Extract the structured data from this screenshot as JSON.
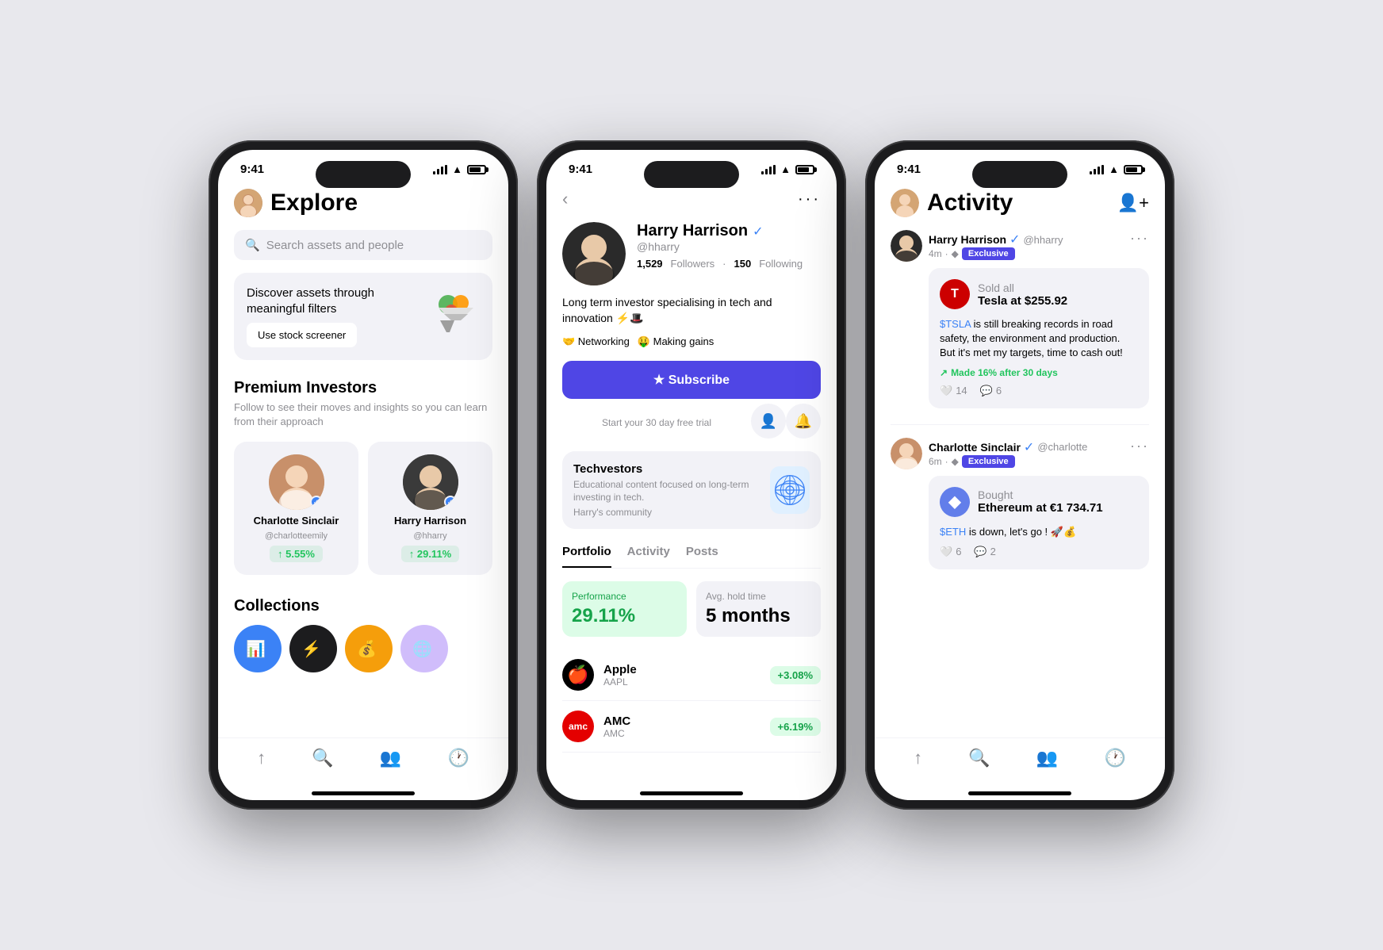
{
  "scene": {
    "bg": "#e8e8ed"
  },
  "phone1": {
    "status": {
      "time": "9:41",
      "signal": "●●●",
      "wifi": "wifi",
      "battery": "battery"
    },
    "header": {
      "title": "Explore",
      "avatar_emoji": "👩"
    },
    "search": {
      "placeholder": "Search assets and people"
    },
    "screener": {
      "title": "Discover assets through meaningful filters",
      "btn_label": "Use stock screener",
      "icon": "🎰"
    },
    "premium": {
      "title": "Premium Investors",
      "subtitle": "Follow to see their moves and insights so you can learn from their approach",
      "investors": [
        {
          "name": "Charlotte Sinclair",
          "handle": "@charlotteemily",
          "return": "↑ 5.55%",
          "verified": true
        },
        {
          "name": "Harry Harrison",
          "handle": "@hharry",
          "return": "↑ 29.11%",
          "verified": true
        }
      ]
    },
    "collections": {
      "title": "Collections"
    },
    "nav": {
      "items": [
        "⬆",
        "🔍",
        "👥",
        "🕐"
      ]
    }
  },
  "phone2": {
    "status": {
      "time": "9:41"
    },
    "profile": {
      "name": "Harry Harrison",
      "handle": "@hharry",
      "followers": "1,529",
      "following": "150",
      "bio": "Long term investor specialising in tech and innovation ⚡🎩",
      "tags": [
        "🤝 Networking",
        "🤑 Making gains"
      ],
      "subscribe_label": "★ Subscribe",
      "trial_text": "Start your 30 day free trial",
      "verified": true
    },
    "community": {
      "name": "Techvestors",
      "desc": "Educational content focused on long-term investing in tech.",
      "author": "Harry's community"
    },
    "tabs": [
      "Portfolio",
      "Activity",
      "Posts"
    ],
    "portfolio": {
      "performance_label": "Performance",
      "performance_val": "29.11%",
      "hold_label": "Avg. hold time",
      "hold_val": "5 months",
      "stocks": [
        {
          "name": "Apple",
          "ticker": "AAPL",
          "return": "+3.08%",
          "logo": "apple"
        },
        {
          "name": "AMC",
          "ticker": "AMC",
          "return": "+6.19%",
          "logo": "amc"
        }
      ]
    }
  },
  "phone3": {
    "status": {
      "time": "9:41"
    },
    "header": {
      "title": "Activity"
    },
    "posts": [
      {
        "user": "Harry Harrison",
        "handle": "@hharry",
        "time": "4m",
        "exclusive": true,
        "trade_action": "Sold all",
        "trade_detail": "Tesla at $255.92",
        "trade_logo": "tesla",
        "text": "$TSLA is still breaking records in road safety, the environment and production. But it's met my targets, time to cash out!",
        "return_text": "Made 16% after 30 days",
        "likes": "14",
        "comments": "6"
      },
      {
        "user": "Charlotte Sinclair",
        "handle": "@charlotte",
        "time": "6m",
        "exclusive": true,
        "trade_action": "Bought",
        "trade_detail": "Ethereum at €1 734.71",
        "trade_logo": "eth",
        "text": "$ETH is down, let's go ! 🚀💰",
        "return_text": "",
        "likes": "6",
        "comments": "2"
      }
    ]
  }
}
